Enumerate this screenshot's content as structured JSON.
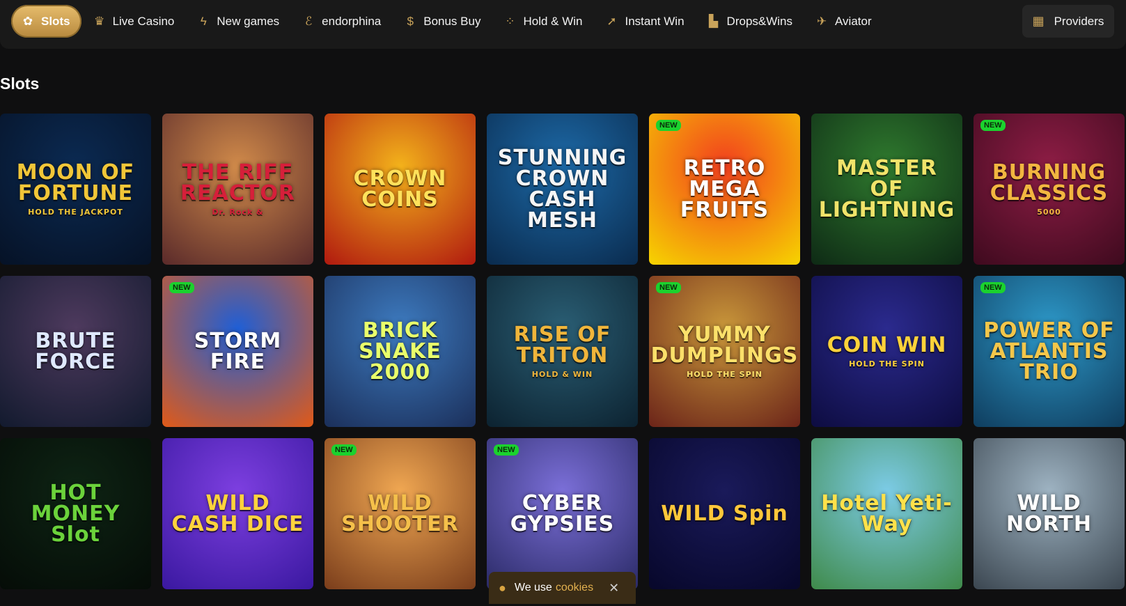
{
  "nav": {
    "items": [
      {
        "label": "Slots",
        "icon": "slots-icon",
        "active": true
      },
      {
        "label": "Live Casino",
        "icon": "live-casino-icon"
      },
      {
        "label": "New games",
        "icon": "lightning-icon"
      },
      {
        "label": "endorphina",
        "icon": "endorphina-icon"
      },
      {
        "label": "Bonus Buy",
        "icon": "bonus-buy-icon"
      },
      {
        "label": "Hold & Win",
        "icon": "hold-win-icon"
      },
      {
        "label": "Instant Win",
        "icon": "rocket-icon"
      },
      {
        "label": "Drops&Wins",
        "icon": "podium-icon"
      },
      {
        "label": "Aviator",
        "icon": "plane-icon"
      }
    ],
    "providers_label": "Providers"
  },
  "section": {
    "title": "Slots"
  },
  "badge_label": "NEW",
  "games": [
    {
      "title": "MOON OF FORTUNE",
      "sub": "HOLD THE JACKPOT",
      "bg1": "#0b2a52",
      "bg2": "#061226",
      "fg": "#f1c638",
      "new": false
    },
    {
      "title": "THE RIFF REACTOR",
      "sub": "Dr. Rock &",
      "bg1": "#d08a4a",
      "bg2": "#5a2a2a",
      "fg": "#d61f3a",
      "new": false
    },
    {
      "title": "CROWN COINS",
      "sub": "",
      "bg1": "#f3b21b",
      "bg2": "#b0190f",
      "fg": "#ffe15b",
      "new": false
    },
    {
      "title": "STUNNING CROWN CASH MESH",
      "sub": "",
      "bg1": "#1d6aa8",
      "bg2": "#0a2b4e",
      "fg": "#f5f5f5",
      "new": false
    },
    {
      "title": "RETRO MEGA FRUITS",
      "sub": "",
      "bg1": "#f23f1e",
      "bg2": "#f6d400",
      "fg": "#ffffff",
      "new": true
    },
    {
      "title": "MASTER OF LIGHTNING",
      "sub": "",
      "bg1": "#2f7a2e",
      "bg2": "#0e2a15",
      "fg": "#f0e36a",
      "new": false
    },
    {
      "title": "BURNING CLASSICS",
      "sub": "5000",
      "bg1": "#8e1d45",
      "bg2": "#3e0a1e",
      "fg": "#f2b640",
      "new": true
    },
    {
      "title": "BRUTE FORCE",
      "sub": "",
      "bg1": "#4e3a5e",
      "bg2": "#121a2e",
      "fg": "#dfe9ff",
      "new": false
    },
    {
      "title": "STORM FIRE",
      "sub": "",
      "bg1": "#1f5fd6",
      "bg2": "#e15a17",
      "fg": "#ffffff",
      "new": true
    },
    {
      "title": "BRICK SNAKE 2000",
      "sub": "",
      "bg1": "#3d7bc0",
      "bg2": "#1b2f5a",
      "fg": "#e9ff6b",
      "new": false
    },
    {
      "title": "RISE OF TRITON",
      "sub": "HOLD & WIN",
      "bg1": "#2a5e74",
      "bg2": "#0c2230",
      "fg": "#f0b53b",
      "new": false
    },
    {
      "title": "YUMMY DUMPLINGS",
      "sub": "HOLD THE SPIN",
      "bg1": "#c9973a",
      "bg2": "#6b2419",
      "fg": "#fbe06a",
      "new": true
    },
    {
      "title": "COIN WIN",
      "sub": "HOLD THE SPIN",
      "bg1": "#2b2a8e",
      "bg2": "#0d0c40",
      "fg": "#ffd23a",
      "new": false
    },
    {
      "title": "POWER OF ATLANTIS TRIO",
      "sub": "",
      "bg1": "#2d98c8",
      "bg2": "#0f3d5e",
      "fg": "#f4c64a",
      "new": true
    },
    {
      "title": "HOT MONEY Slot",
      "sub": "",
      "bg1": "#0e2414",
      "bg2": "#050c07",
      "fg": "#6bd23b",
      "new": false
    },
    {
      "title": "WILD CASH DICE",
      "sub": "",
      "bg1": "#7d3fe0",
      "bg2": "#3a18a0",
      "fg": "#ffd33d",
      "new": false
    },
    {
      "title": "WILD SHOOTER",
      "sub": "",
      "bg1": "#f0a752",
      "bg2": "#7a3d1b",
      "fg": "#f5c04a",
      "new": true
    },
    {
      "title": "CYBER GYPSIES",
      "sub": "",
      "bg1": "#7b6fd8",
      "bg2": "#2a2a66",
      "fg": "#ffffff",
      "new": true
    },
    {
      "title": "WILD Spin",
      "sub": "",
      "bg1": "#1a1a5a",
      "bg2": "#07072a",
      "fg": "#ffc73a",
      "new": false
    },
    {
      "title": "Hotel Yeti-Way",
      "sub": "",
      "bg1": "#7ccbe6",
      "bg2": "#3f8a4a",
      "fg": "#ffe14a",
      "new": false
    },
    {
      "title": "WILD NORTH",
      "sub": "",
      "bg1": "#9eb3c2",
      "bg2": "#3b4650",
      "fg": "#ffffff",
      "new": false
    }
  ],
  "cookie": {
    "text": "We use",
    "link": "cookies",
    "close": "✕"
  }
}
